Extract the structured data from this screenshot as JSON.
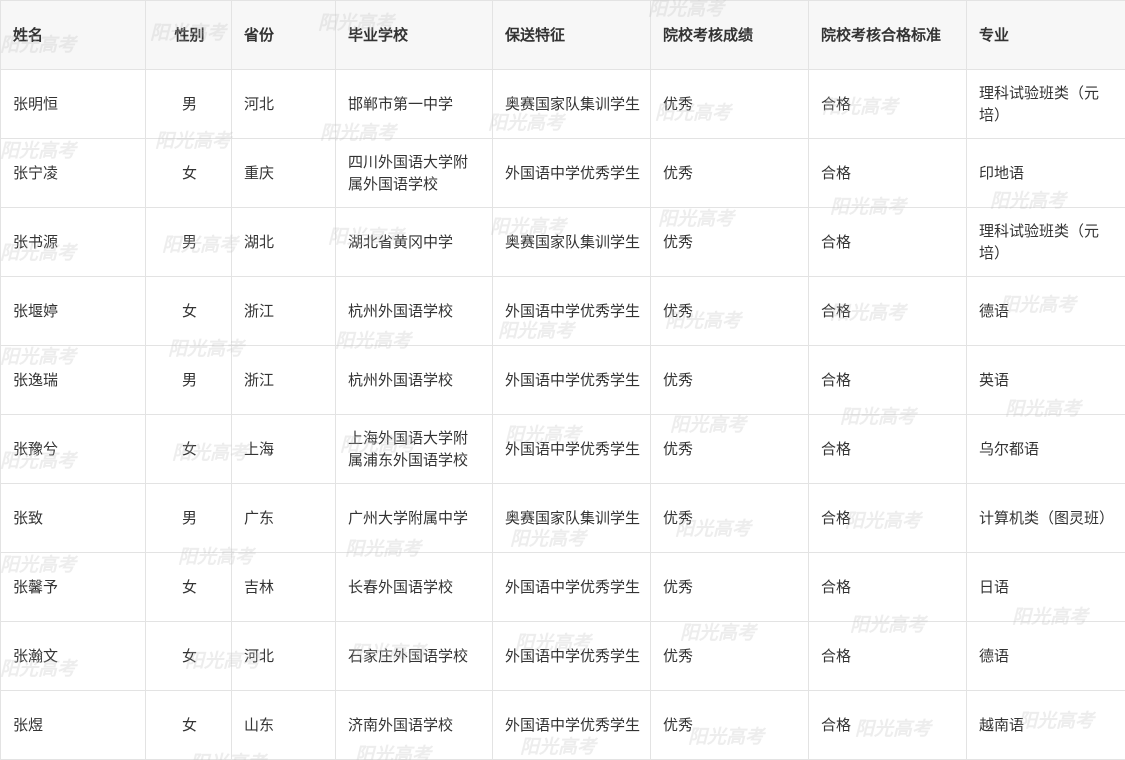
{
  "table": {
    "headers": [
      "姓名",
      "性别",
      "省份",
      "毕业学校",
      "保送特征",
      "院校考核成绩",
      "院校考核合格标准",
      "专业"
    ],
    "rows": [
      [
        "张明恒",
        "男",
        "河北",
        "邯郸市第一中学",
        "奥赛国家队集训学生",
        "优秀",
        "合格",
        "理科试验班类（元培）"
      ],
      [
        "张宁凌",
        "女",
        "重庆",
        "四川外国语大学附属外国语学校",
        "外国语中学优秀学生",
        "优秀",
        "合格",
        "印地语"
      ],
      [
        "张书源",
        "男",
        "湖北",
        "湖北省黄冈中学",
        "奥赛国家队集训学生",
        "优秀",
        "合格",
        "理科试验班类（元培）"
      ],
      [
        "张堰婷",
        "女",
        "浙江",
        "杭州外国语学校",
        "外国语中学优秀学生",
        "优秀",
        "合格",
        "德语"
      ],
      [
        "张逸瑞",
        "男",
        "浙江",
        "杭州外国语学校",
        "外国语中学优秀学生",
        "优秀",
        "合格",
        "英语"
      ],
      [
        "张豫兮",
        "女",
        "上海",
        "上海外国语大学附属浦东外国语学校",
        "外国语中学优秀学生",
        "优秀",
        "合格",
        "乌尔都语"
      ],
      [
        "张致",
        "男",
        "广东",
        "广州大学附属中学",
        "奥赛国家队集训学生",
        "优秀",
        "合格",
        "计算机类（图灵班）"
      ],
      [
        "张馨予",
        "女",
        "吉林",
        "长春外国语学校",
        "外国语中学优秀学生",
        "优秀",
        "合格",
        "日语"
      ],
      [
        "张瀚文",
        "女",
        "河北",
        "石家庄外国语学校",
        "外国语中学优秀学生",
        "优秀",
        "合格",
        "德语"
      ],
      [
        "张煜",
        "女",
        "山东",
        "济南外国语学校",
        "外国语中学优秀学生",
        "优秀",
        "合格",
        "越南语"
      ]
    ]
  },
  "watermark": {
    "text": "阳光高考",
    "color": "#bebebe"
  }
}
